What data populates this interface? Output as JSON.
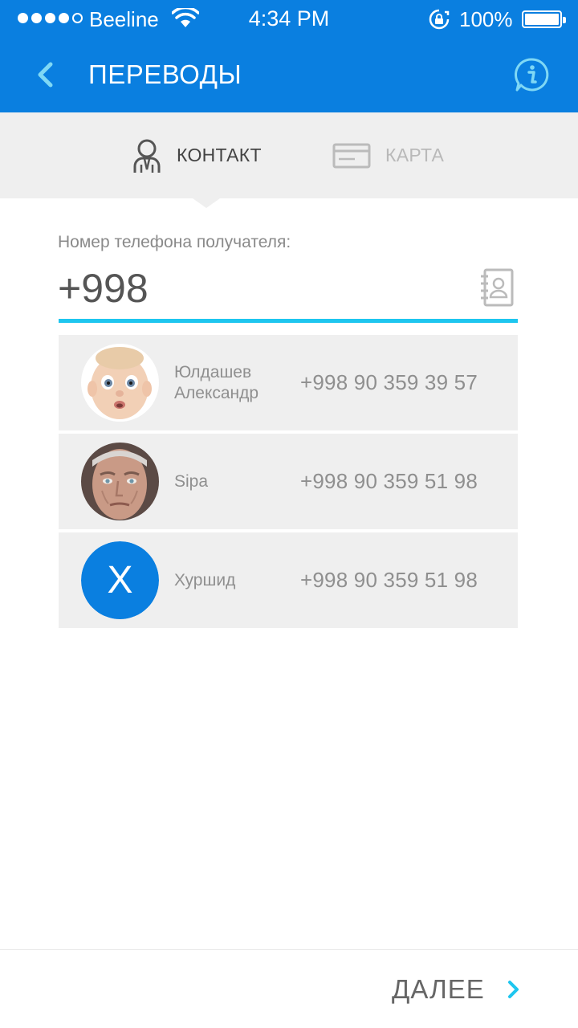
{
  "status_bar": {
    "carrier": "Beeline",
    "time": "4:34 PM",
    "battery": "100%"
  },
  "nav": {
    "title": "ПЕРЕВОДЫ"
  },
  "tabs": [
    {
      "label": "КОНТАКТ",
      "icon": "person-icon",
      "active": true
    },
    {
      "label": "КАРТА",
      "icon": "card-icon",
      "active": false
    }
  ],
  "phone_field": {
    "label": "Номер телефона получателя:",
    "value": "+998"
  },
  "contacts": [
    {
      "name": "Юлдашев\nАлександр",
      "phone": "+998 90 359 39 57",
      "avatar": "photo-baby"
    },
    {
      "name": "Sipa",
      "phone": "+998 90 359 51 98",
      "avatar": "photo-man"
    },
    {
      "name": "Хуршид",
      "phone": "+998 90 359 51 98",
      "avatar": "letter",
      "letter": "X"
    }
  ],
  "footer": {
    "next_label": "ДАЛЕЕ"
  },
  "colors": {
    "primary": "#0a7fe0",
    "accent": "#1ec6ef",
    "tab_bg": "#efefef"
  }
}
